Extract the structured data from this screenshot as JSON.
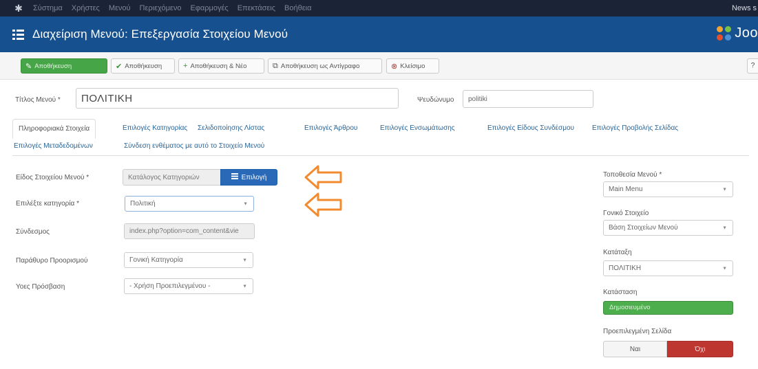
{
  "topbar": {
    "menu": [
      "Σύστημα",
      "Χρήστες",
      "Μενού",
      "Περιεχόμενο",
      "Εφαρμογές",
      "Επεκτάσεις",
      "Βοήθεια"
    ],
    "right_text": "News s"
  },
  "header": {
    "title": "Διαχείριση Μενού: Επεξεργασία Στοιχείου Μενού",
    "brand": "Joo"
  },
  "toolbar": {
    "save": "Αποθήκευση",
    "save_close": "Αποθήκευση",
    "save_new": "Αποθήκευση & Νέο",
    "save_copy": "Αποθήκευση ως Αντίγραφο",
    "close": "Κλείσιμο",
    "help_icon": "question-icon"
  },
  "form": {
    "title_label": "Τίτλος Μενού *",
    "title_value": "ΠΟΛΙΤΙΚΗ",
    "alias_label": "Ψευδώνυμο",
    "alias_value": "politiki"
  },
  "tabs": [
    "Πληροφοριακά Στοιχεία",
    "Επιλογές Κατηγορίας",
    "Σελιδοποίησης Λίστας",
    "Επιλογές Άρθρου",
    "Επιλογές Ενσωμάτωσης",
    "Επιλογές Είδους Συνδέσμου",
    "Επιλογές Προβολής Σελίδας",
    "Επιλογές Μεταδεδομένων",
    "Σύνδεση ενθέματος με αυτό το Στοιχείο Μενού"
  ],
  "left": {
    "type_label": "Είδος Στοιχείου Μενού *",
    "type_value": "Κατάλογος Κατηγοριών",
    "select_button": "Επιλογή",
    "category_label": "Επιλέξτε κατηγορία *",
    "category_value": "Πολιτική",
    "link_label": "Σύνδεσμος",
    "link_value": "index.php?option=com_content&vie",
    "window_label": "Παράθυρο Προορισμού",
    "window_value": "Γονική Κατηγορία",
    "access_label": "Υοες Πρόσβαση",
    "access_value": "- Χρήση Προεπιλεγμένου -"
  },
  "right": {
    "menu_label": "Τοποθεσία Μενού *",
    "menu_value": "Main Menu",
    "parent_label": "Γονικό Στοιχείο",
    "parent_value": "Βάση Στοιχείων Μενού",
    "order_label": "Κατάταξη",
    "order_value": "ΠΟΛΙΤΙΚΗ",
    "status_label": "Κατάσταση",
    "status_value": "Δημοσιευμένο",
    "home_label": "Προεπιλεγμένη Σελίδα",
    "home_no": "Ναι",
    "home_yes": "Όχι"
  },
  "colors": {
    "header_bg": "#17508e",
    "topbar_bg": "#1b2436",
    "success": "#46a546",
    "danger": "#bd362f",
    "primary_btn": "#2a69b8",
    "annotation_arrow": "#f28a2e"
  }
}
